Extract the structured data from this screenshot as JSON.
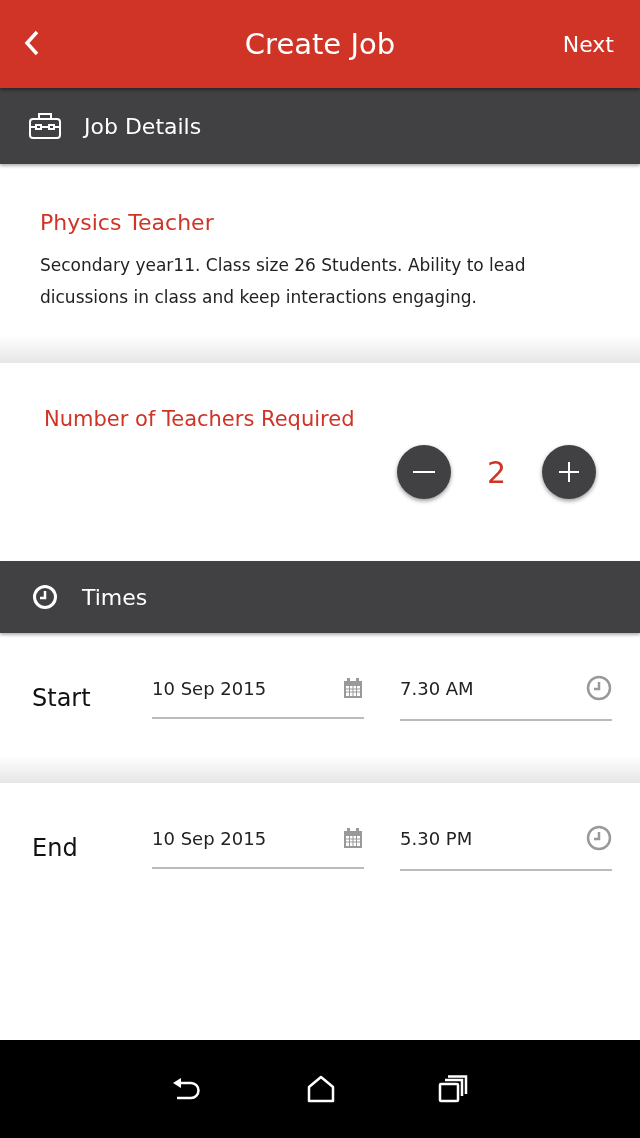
{
  "app_bar": {
    "title": "Create Job",
    "action": "Next"
  },
  "job_section": {
    "title": "Job Details"
  },
  "job": {
    "title": "Physics Teacher",
    "description": "Secondary year11. Class size 26 Students. Ability to lead dicussions in class and keep interactions engaging."
  },
  "teachers": {
    "label": "Number of Teachers Required",
    "count": "2"
  },
  "times_section": {
    "title": "Times"
  },
  "times": [
    {
      "label": "Start",
      "date": "10 Sep 2015",
      "time": "7.30 AM"
    },
    {
      "label": "End",
      "date": "10 Sep 2015",
      "time": "5.30 PM"
    }
  ]
}
